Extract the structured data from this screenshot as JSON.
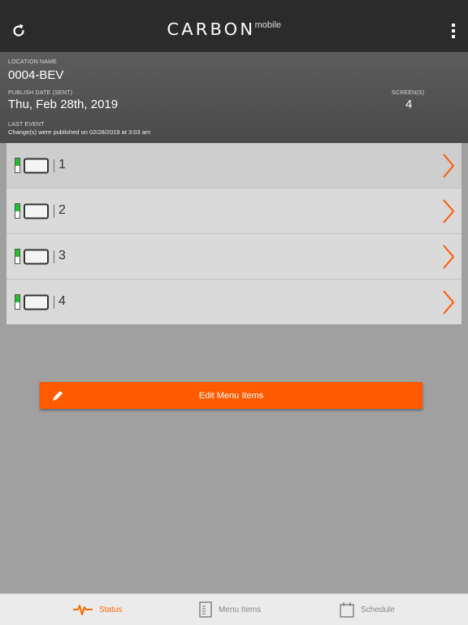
{
  "header": {
    "logo_main": "CARBON",
    "logo_sub": "mobile"
  },
  "info": {
    "location_label": "LOCATION NAME",
    "location_value": "0004-BEV",
    "publish_label": "PUBLISH DATE (SENT)",
    "publish_value": "Thu, Feb 28th, 2019",
    "screens_label": "SCREEN(S)",
    "screens_value": "4",
    "event_label": "LAST EVENT",
    "event_value": "Change(s) were published on 02/28/2019 at 3:03 am"
  },
  "screens": [
    {
      "number": "1"
    },
    {
      "number": "2"
    },
    {
      "number": "3"
    },
    {
      "number": "4"
    }
  ],
  "actions": {
    "edit_label": "Edit Menu Items"
  },
  "tabs": [
    {
      "label": "Status",
      "icon": "pulse-icon"
    },
    {
      "label": "Menu Items",
      "icon": "menu-document-icon"
    },
    {
      "label": "Schedule",
      "icon": "calendar-icon"
    }
  ],
  "colors": {
    "accent": "#ff5a00",
    "status_green": "#1fbf2f",
    "topbar": "#2b2b2b"
  }
}
